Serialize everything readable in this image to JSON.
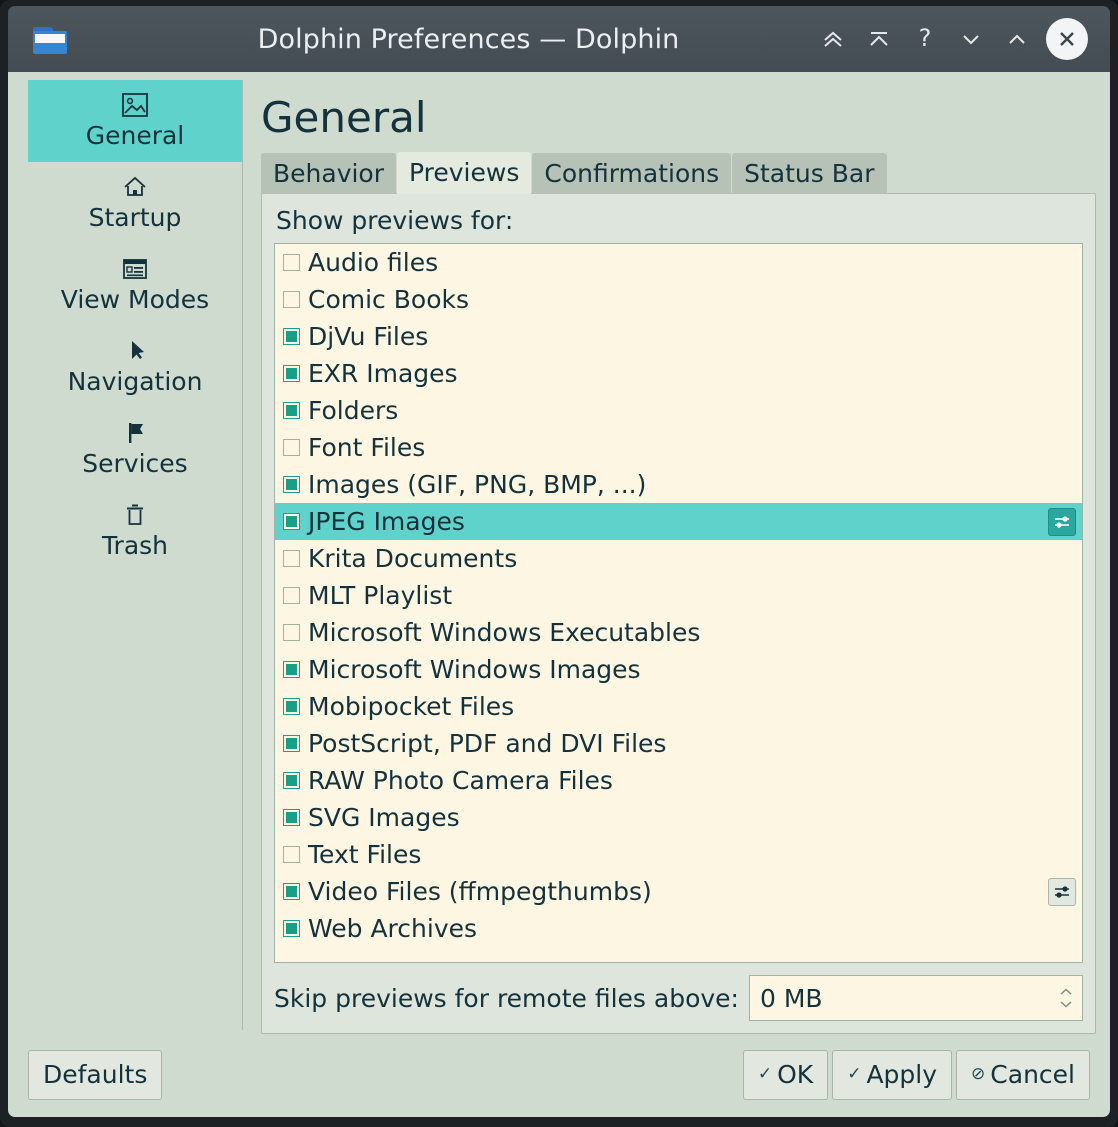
{
  "window": {
    "title": "Dolphin Preferences — Dolphin",
    "app_icon": "folder-icon",
    "controls": [
      {
        "name": "keep-above-icon",
        "label": "Keep Above"
      },
      {
        "name": "shade-icon",
        "label": "Shade"
      },
      {
        "name": "help-icon",
        "label": "?"
      },
      {
        "name": "minimize-icon",
        "label": "Minimize"
      },
      {
        "name": "maximize-icon",
        "label": "Maximize"
      },
      {
        "name": "close-icon",
        "label": "Close"
      }
    ]
  },
  "sidebar": {
    "items": [
      {
        "label": "General",
        "icon": "image-preview-icon",
        "active": true
      },
      {
        "label": "Startup",
        "icon": "home-icon",
        "active": false
      },
      {
        "label": "View Modes",
        "icon": "view-list-icon",
        "active": false
      },
      {
        "label": "Navigation",
        "icon": "cursor-arrow-icon",
        "active": false
      },
      {
        "label": "Services",
        "icon": "flag-icon",
        "active": false
      },
      {
        "label": "Trash",
        "icon": "trash-icon",
        "active": false
      }
    ]
  },
  "page": {
    "title": "General",
    "tabs": [
      {
        "label": "Behavior",
        "active": false
      },
      {
        "label": "Previews",
        "active": true
      },
      {
        "label": "Confirmations",
        "active": false
      },
      {
        "label": "Status Bar",
        "active": false
      }
    ],
    "group_label": "Show previews for:",
    "list": [
      {
        "label": "Audio files",
        "checked": false,
        "selected": false,
        "config": "none"
      },
      {
        "label": "Comic Books",
        "checked": false,
        "selected": false,
        "config": "none"
      },
      {
        "label": "DjVu Files",
        "checked": true,
        "selected": false,
        "config": "none"
      },
      {
        "label": "EXR Images",
        "checked": true,
        "selected": false,
        "config": "none"
      },
      {
        "label": "Folders",
        "checked": true,
        "selected": false,
        "config": "none"
      },
      {
        "label": "Font Files",
        "checked": false,
        "selected": false,
        "config": "none"
      },
      {
        "label": "Images (GIF, PNG, BMP, ...)",
        "checked": true,
        "selected": false,
        "config": "none"
      },
      {
        "label": "JPEG Images",
        "checked": true,
        "selected": true,
        "config": "teal"
      },
      {
        "label": "Krita Documents",
        "checked": false,
        "selected": false,
        "config": "none"
      },
      {
        "label": "MLT Playlist",
        "checked": false,
        "selected": false,
        "config": "none"
      },
      {
        "label": "Microsoft Windows Executables",
        "checked": false,
        "selected": false,
        "config": "none"
      },
      {
        "label": "Microsoft Windows Images",
        "checked": true,
        "selected": false,
        "config": "none"
      },
      {
        "label": "Mobipocket Files",
        "checked": true,
        "selected": false,
        "config": "none"
      },
      {
        "label": "PostScript, PDF and DVI Files",
        "checked": true,
        "selected": false,
        "config": "none"
      },
      {
        "label": "RAW Photo Camera Files",
        "checked": true,
        "selected": false,
        "config": "none"
      },
      {
        "label": "SVG Images",
        "checked": true,
        "selected": false,
        "config": "none"
      },
      {
        "label": "Text Files",
        "checked": false,
        "selected": false,
        "config": "none"
      },
      {
        "label": "Video Files (ffmpegthumbs)",
        "checked": true,
        "selected": false,
        "config": "plain"
      },
      {
        "label": "Web Archives",
        "checked": true,
        "selected": false,
        "config": "none"
      }
    ],
    "skip_label": "Skip previews for remote files above:",
    "skip_value": "0 MB"
  },
  "footer": {
    "defaults_label": "Defaults",
    "ok_label": "OK",
    "apply_label": "Apply",
    "cancel_label": "Cancel",
    "ok_glyph": "✓",
    "apply_glyph": "✓",
    "cancel_glyph": "⊘"
  },
  "colors": {
    "titlebar": "#475057",
    "dialog_bg": "#cfdbcf",
    "accent_teal": "#5fd3cb",
    "check_teal": "#16a085",
    "list_bg": "#fdf6e3",
    "text": "#14323c",
    "tab_inactive": "#b6c2b6",
    "tab_active": "#e4eadd"
  }
}
